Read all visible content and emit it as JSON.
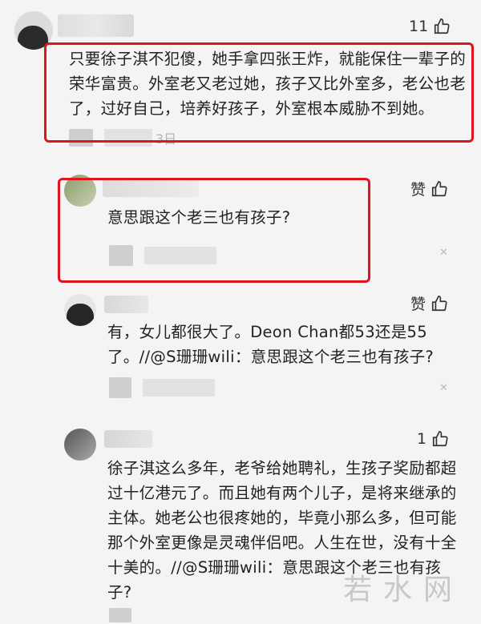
{
  "comments": [
    {
      "likes": "11",
      "text": "只要徐子淇不犯傻，她手拿四张王炸，就能保住一辈子的荣华富贵。外室老又老过她，孩子又比外室多，老公也老了，过好自己，培养好孩子，外室根本威胁不到她。",
      "meta": "3日"
    },
    {
      "likes": "赞",
      "text": "意思跟这个老三也有孩子?"
    },
    {
      "likes": "赞",
      "text": "有，女儿都很大了。Deon Chan都53还是55了。//@S珊珊wili：意思跟这个老三也有孩子?"
    },
    {
      "likes": "1",
      "text": "徐子淇这么多年，老爷给她聘礼，生孩子奖励都超过十亿港元了。而且她有两个儿子，是将来继承的主体。她老公也很疼她的，毕竟小那么多，但可能那个外室更像是灵魂伴侣吧。人生在世，没有十全十美的。//@S珊珊wili：意思跟这个老三也有孩子?"
    }
  ],
  "watermark": "若水网",
  "icons": {
    "like": "thumbs-up-icon",
    "more": "more-options-icon"
  },
  "colors": {
    "highlight": "#e0141e",
    "background": "#f4f4f4"
  }
}
